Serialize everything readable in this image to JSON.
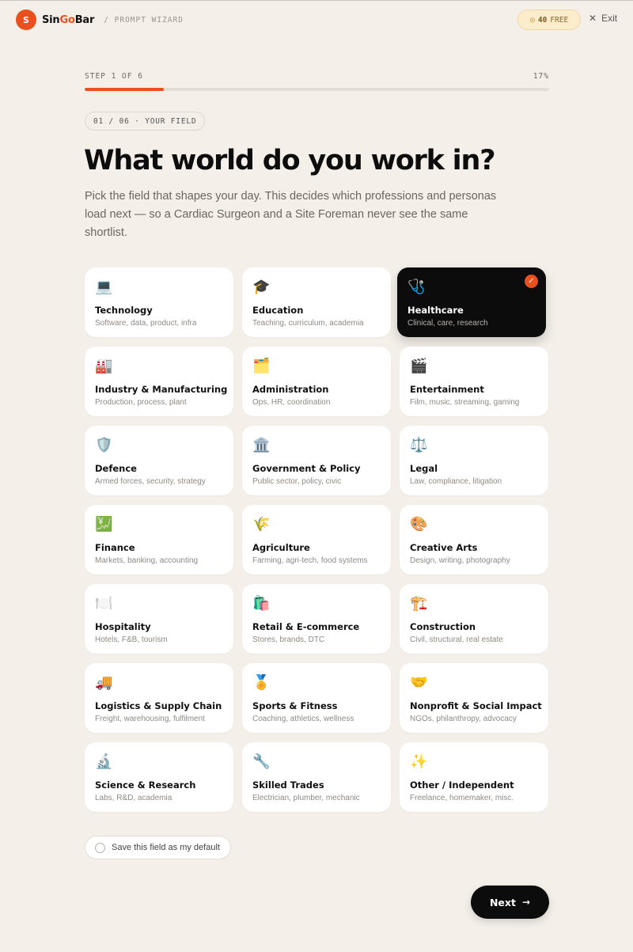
{
  "header": {
    "logo_letter": "S",
    "brand_prefix": "Sin",
    "brand_accent": "Go",
    "brand_suffix": "Bar",
    "crumb": "/ PROMPT WIZARD",
    "credits_value": "40",
    "credits_label": "FREE",
    "credits_icon": "coin-icon",
    "exit_label": "Exit"
  },
  "progress": {
    "step_label": "STEP 1 OF 6",
    "percent_label": "17%",
    "fraction": 0.17
  },
  "step_pill": "01 / 06 · YOUR FIELD",
  "title": "What world do you work in?",
  "lede": "Pick the field that shapes your day. This decides which professions and personas load next — so a Cardiac Surgeon and a Site Foreman never see the same shortlist.",
  "fields": [
    {
      "icon": "💻",
      "icon_name": "laptop-icon",
      "label": "Technology",
      "desc": "Software, data, product, infra",
      "selected": false
    },
    {
      "icon": "🎓",
      "icon_name": "graduation-cap-icon",
      "label": "Education",
      "desc": "Teaching, curriculum, academia",
      "selected": false
    },
    {
      "icon": "🩺",
      "icon_name": "stethoscope-icon",
      "label": "Healthcare",
      "desc": "Clinical, care, research",
      "selected": true
    },
    {
      "icon": "🏭",
      "icon_name": "factory-icon",
      "label": "Industry & Manufacturing",
      "desc": "Production, process, plant",
      "selected": false
    },
    {
      "icon": "🗂️",
      "icon_name": "folder-icon",
      "label": "Administration",
      "desc": "Ops, HR, coordination",
      "selected": false
    },
    {
      "icon": "🎬",
      "icon_name": "clapperboard-icon",
      "label": "Entertainment",
      "desc": "Film, music, streaming, gaming",
      "selected": false
    },
    {
      "icon": "🛡️",
      "icon_name": "shield-icon",
      "label": "Defence",
      "desc": "Armed forces, security, strategy",
      "selected": false
    },
    {
      "icon": "🏛️",
      "icon_name": "classical-building-icon",
      "label": "Government & Policy",
      "desc": "Public sector, policy, civic",
      "selected": false
    },
    {
      "icon": "⚖️",
      "icon_name": "scales-icon",
      "label": "Legal",
      "desc": "Law, compliance, litigation",
      "selected": false
    },
    {
      "icon": "💹",
      "icon_name": "chart-yen-icon",
      "label": "Finance",
      "desc": "Markets, banking, accounting",
      "selected": false
    },
    {
      "icon": "🌾",
      "icon_name": "wheat-icon",
      "label": "Agriculture",
      "desc": "Farming, agri-tech, food systems",
      "selected": false
    },
    {
      "icon": "🎨",
      "icon_name": "palette-icon",
      "label": "Creative Arts",
      "desc": "Design, writing, photography",
      "selected": false
    },
    {
      "icon": "🍽️",
      "icon_name": "plate-cutlery-icon",
      "label": "Hospitality",
      "desc": "Hotels, F&B, tourism",
      "selected": false
    },
    {
      "icon": "🛍️",
      "icon_name": "shopping-bags-icon",
      "label": "Retail & E-commerce",
      "desc": "Stores, brands, DTC",
      "selected": false
    },
    {
      "icon": "🏗️",
      "icon_name": "crane-icon",
      "label": "Construction",
      "desc": "Civil, structural, real estate",
      "selected": false
    },
    {
      "icon": "🚚",
      "icon_name": "truck-icon",
      "label": "Logistics & Supply Chain",
      "desc": "Freight, warehousing, fulfilment",
      "selected": false
    },
    {
      "icon": "🏅",
      "icon_name": "medal-icon",
      "label": "Sports & Fitness",
      "desc": "Coaching, athletics, wellness",
      "selected": false
    },
    {
      "icon": "🤝",
      "icon_name": "handshake-icon",
      "label": "Nonprofit & Social Impact",
      "desc": "NGOs, philanthropy, advocacy",
      "selected": false
    },
    {
      "icon": "🔬",
      "icon_name": "microscope-icon",
      "label": "Science & Research",
      "desc": "Labs, R&D, academia",
      "selected": false
    },
    {
      "icon": "🔧",
      "icon_name": "wrench-icon",
      "label": "Skilled Trades",
      "desc": "Electrician, plumber, mechanic",
      "selected": false
    },
    {
      "icon": "✨",
      "icon_name": "sparkles-icon",
      "label": "Other / Independent",
      "desc": "Freelance, homemaker, misc.",
      "selected": false
    }
  ],
  "save_default_label": "Save this field as my default",
  "next_label": "Next",
  "colors": {
    "accent": "#e9501e",
    "background": "#f4efe9",
    "selected_card": "#0c0c0c"
  }
}
